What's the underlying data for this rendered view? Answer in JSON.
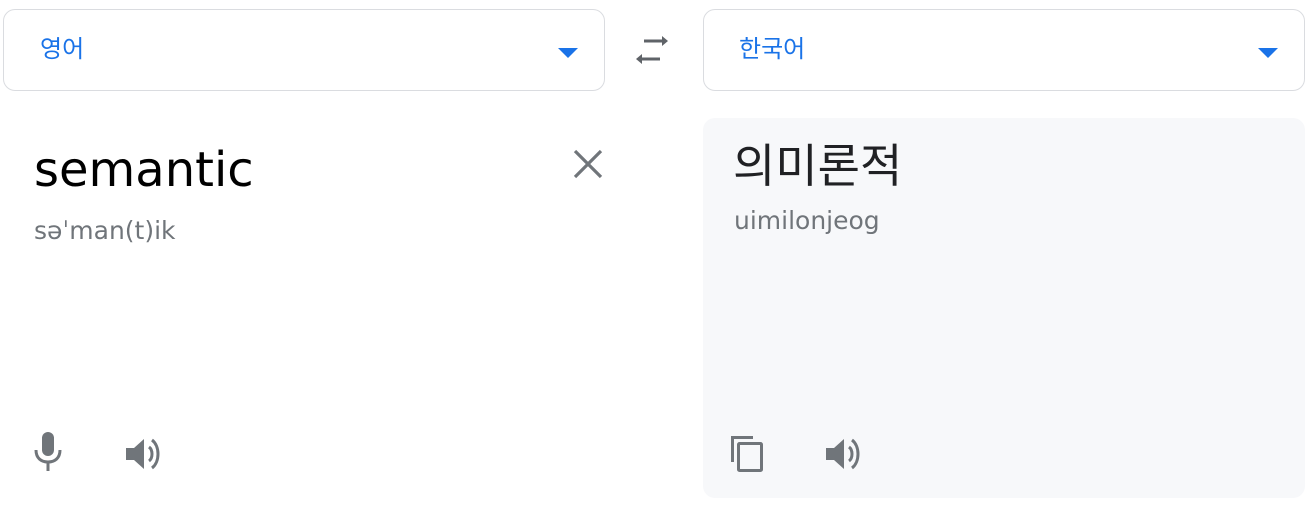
{
  "source_language": {
    "label": "영어"
  },
  "target_language": {
    "label": "한국어"
  },
  "source": {
    "text": "semantic",
    "phonetic": "səˈman(t)ik"
  },
  "target": {
    "text": "의미론적",
    "romanization": "uimilonjeog"
  },
  "icons": {
    "dropdown": "caret-down-icon",
    "swap": "swap-icon",
    "clear": "close-icon",
    "mic": "microphone-icon",
    "speaker": "speaker-icon",
    "copy": "copy-icon"
  },
  "colors": {
    "accent": "#1a73e8",
    "icon": "#70757a",
    "target_background": "#f7f8fa",
    "border": "#dadce0"
  }
}
